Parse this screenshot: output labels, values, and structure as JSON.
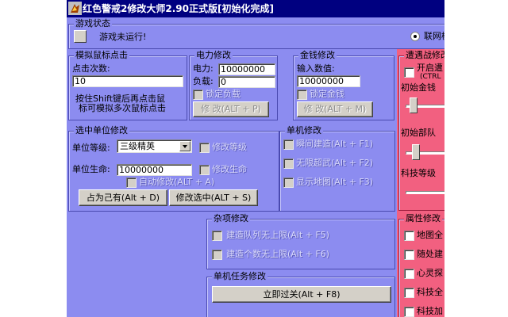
{
  "window": {
    "title": "红色警戒2修改大师2.90正式版[初始化完成]"
  },
  "game_status": {
    "legend": "游戏状态",
    "status_text": "游戏未运行!",
    "online_radio": "联网模"
  },
  "mouse_sim": {
    "legend": "模拟鼠标点击",
    "clicks_label": "点击次数:",
    "clicks_value": "10",
    "hint_line1": "按住Shift键后再点击鼠",
    "hint_line2": "标可模拟多次鼠标点击"
  },
  "power": {
    "legend": "电力修改",
    "power_label": "电力:",
    "power_value": "10000000",
    "load_label": "负载:",
    "load_value": "0",
    "lock_label": "锁定负载",
    "modify_button": "修 改(ALT + P)"
  },
  "money": {
    "legend": "金钱修改",
    "input_label": "输入数值:",
    "input_value": "10000000",
    "lock_label": "锁定金钱",
    "modify_button": "修 改(ALT + M)"
  },
  "selected_unit": {
    "legend": "选中单位修改",
    "level_label": "单位等级:",
    "level_value": "三级精英",
    "modify_level_label": "修改等级",
    "life_label": "单位生命:",
    "life_value": "10000000",
    "modify_life_label": "修改生命",
    "auto_modify_label": "自动修改(ALT + A)",
    "own_button": "占为己有(Alt + D)",
    "modify_selected_button": "修改选中(ALT + S)"
  },
  "single_player": {
    "legend": "单机修改",
    "items": [
      "瞬间建造(Alt + F1)",
      "无限超武(Alt + F2)",
      "显示地图(Alt + F3)"
    ]
  },
  "misc": {
    "legend": "杂项修改",
    "items": [
      "建造队列无上限(Alt + F5)",
      "建造个数无上限(Alt + F6)"
    ]
  },
  "mission": {
    "legend": "单机任务修改",
    "win_button": "立即过关(Alt + F8)"
  },
  "pre_battle": {
    "legend": "遭遇战修改",
    "enable_label": "开启遭",
    "enable_sub": "(CTRL",
    "init_money_label": "初始金钱",
    "init_units_label": "初始部队",
    "tech_level_label": "科技等级",
    "init_money_slider": 0.08,
    "init_units_slider": 0.13
  },
  "attributes": {
    "legend": "属性修改",
    "items": [
      "地图全",
      "随处建",
      "心灵探",
      "科技全",
      "科技加"
    ]
  },
  "colors": {
    "window_bg": "#8c8cf0",
    "titlebar": "#000080",
    "pink_panel": "#f26080"
  }
}
